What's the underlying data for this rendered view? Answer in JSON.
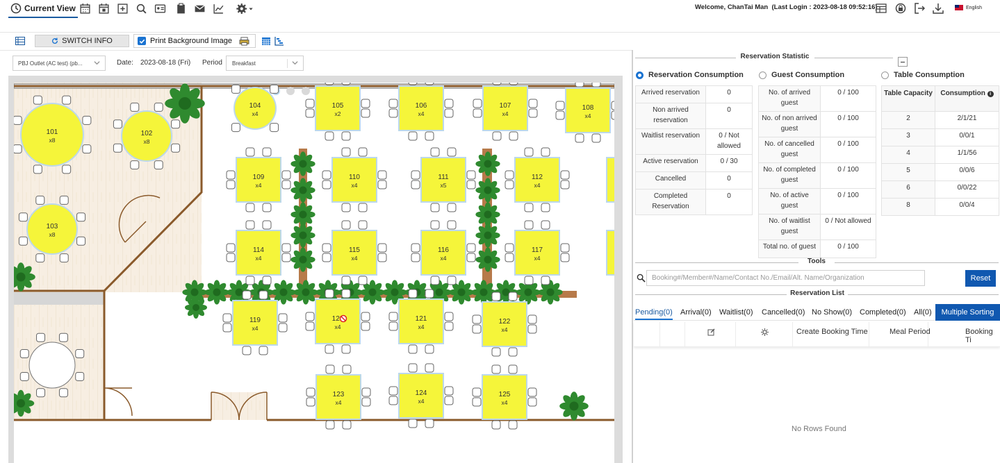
{
  "header": {
    "current_view_label": "Current View",
    "welcome": "Welcome, ChanTai Man",
    "last_login": "(Last Login : 2023-08-18 09:52:16)",
    "language": "English"
  },
  "toolbar": {
    "switch_info_label": "SWITCH INFO",
    "print_bg_label": "Print Background Image",
    "print_bg_checked": true
  },
  "filters": {
    "outlet_value": "PBJ Outlet (AC test) (pb...",
    "date_label": "Date:",
    "date_value": "2023-08-18 (Fri)",
    "period_label": "Period",
    "period_value": "Breakfast"
  },
  "floor_plan": {
    "tables": [
      {
        "no": "101",
        "cap": "x8",
        "shape": "round"
      },
      {
        "no": "102",
        "cap": "x8",
        "shape": "round"
      },
      {
        "no": "103",
        "cap": "x8",
        "shape": "round"
      },
      {
        "no": "104",
        "cap": "x4",
        "shape": "round"
      },
      {
        "no": "105",
        "cap": "x2",
        "shape": "square"
      },
      {
        "no": "106",
        "cap": "x4",
        "shape": "square"
      },
      {
        "no": "107",
        "cap": "x4",
        "shape": "square"
      },
      {
        "no": "108",
        "cap": "x4",
        "shape": "square"
      },
      {
        "no": "109",
        "cap": "x4",
        "shape": "square"
      },
      {
        "no": "110",
        "cap": "x4",
        "shape": "square"
      },
      {
        "no": "111",
        "cap": "x5",
        "shape": "square"
      },
      {
        "no": "112",
        "cap": "x4",
        "shape": "square"
      },
      {
        "no": "114",
        "cap": "x4",
        "shape": "square"
      },
      {
        "no": "115",
        "cap": "x4",
        "shape": "square"
      },
      {
        "no": "116",
        "cap": "x4",
        "shape": "square"
      },
      {
        "no": "117",
        "cap": "x4",
        "shape": "square"
      },
      {
        "no": "119",
        "cap": "x4",
        "shape": "square"
      },
      {
        "no": "120",
        "cap": "x4",
        "shape": "square",
        "blocked": true
      },
      {
        "no": "121",
        "cap": "x4",
        "shape": "square"
      },
      {
        "no": "122",
        "cap": "x4",
        "shape": "square"
      },
      {
        "no": "123",
        "cap": "x4",
        "shape": "square"
      },
      {
        "no": "124",
        "cap": "x4",
        "shape": "square"
      },
      {
        "no": "125",
        "cap": "x4",
        "shape": "square"
      }
    ],
    "table_color": "#f5f53a",
    "floor_color": "#f7eee2",
    "wall_color": "#8a5a2b"
  },
  "statistic": {
    "title": "Reservation Statistic",
    "radios": [
      "Reservation Consumption",
      "Guest Consumption",
      "Table Consumption"
    ],
    "selected_radio": "Reservation Consumption",
    "reservation": [
      [
        "Arrived reservation",
        "0"
      ],
      [
        "Non arrived reservation",
        "0"
      ],
      [
        "Waitlist reservation",
        "0 / Not allowed"
      ],
      [
        "Active reservation",
        "0 / 30"
      ],
      [
        "Cancelled",
        "0"
      ],
      [
        "Completed Reservation",
        "0"
      ]
    ],
    "guest": [
      [
        "No. of arrived guest",
        "0 / 100"
      ],
      [
        "No. of non arrived guest",
        "0 / 100"
      ],
      [
        "No. of cancelled guest",
        "0 / 100"
      ],
      [
        "No. of completed guest",
        "0 / 100"
      ],
      [
        "No. of active guest",
        "0 / 100"
      ],
      [
        "No. of waitlist guest",
        "0 / Not allowed"
      ],
      [
        "Total no. of guest",
        "0 / 100"
      ]
    ],
    "table_headers": [
      "Table Capacity",
      "Consumption"
    ],
    "table": [
      [
        "2",
        "2/1/21"
      ],
      [
        "3",
        "0/0/1"
      ],
      [
        "4",
        "1/1/56"
      ],
      [
        "5",
        "0/0/6"
      ],
      [
        "6",
        "0/0/22"
      ],
      [
        "8",
        "0/0/4"
      ]
    ]
  },
  "tools": {
    "title": "Tools",
    "search_placeholder": "Booking#/Member#/Name/Contact No./Email/Alt. Name/Organization",
    "reset_label": "Reset"
  },
  "reservation_list": {
    "title": "Reservation List",
    "tabs": [
      "Pending(0)",
      "Arrival(0)",
      "Waitlist(0)",
      "Cancelled(0)",
      "No Show(0)",
      "Completed(0)",
      "All(0)"
    ],
    "active_tab": "Pending(0)",
    "multiple_sorting_label": "Multiple Sorting",
    "columns": [
      "Create Booking Time",
      "Meal Period",
      "Booking Ti"
    ],
    "empty_text": "No Rows Found"
  }
}
